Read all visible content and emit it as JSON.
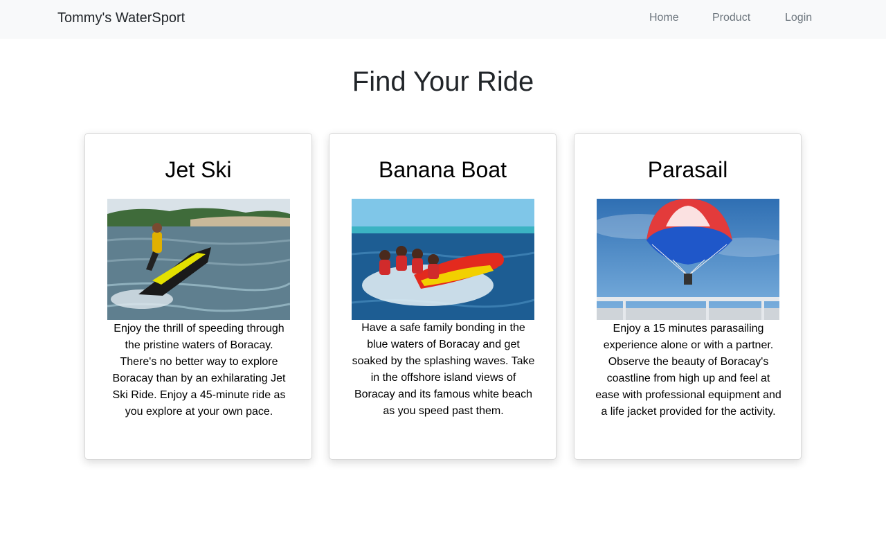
{
  "navbar": {
    "brand": "Tommy's WaterSport",
    "links": [
      "Home",
      "Product",
      "Login"
    ]
  },
  "page_title": "Find Your Ride",
  "cards": [
    {
      "title": "Jet Ski",
      "image": "jet-ski-photo",
      "description": "Enjoy the thrill of speeding through the pristine waters of Boracay. There's no better way to explore Boracay than by an exhilarating Jet Ski Ride. Enjoy a 45-minute ride as you explore at your own pace."
    },
    {
      "title": "Banana Boat",
      "image": "banana-boat-photo",
      "description": "Have a safe family bonding in the blue waters of Boracay and get soaked by the splashing waves. Take in the offshore island views of Boracay and its famous white beach as you speed past them."
    },
    {
      "title": "Parasail",
      "image": "parasail-photo",
      "description": "Enjoy a 15 minutes parasailing experience alone or with a partner. Observe the beauty of Boracay's coastline from high up and feel at ease with professional equipment and a life jacket provided for the activity."
    }
  ]
}
